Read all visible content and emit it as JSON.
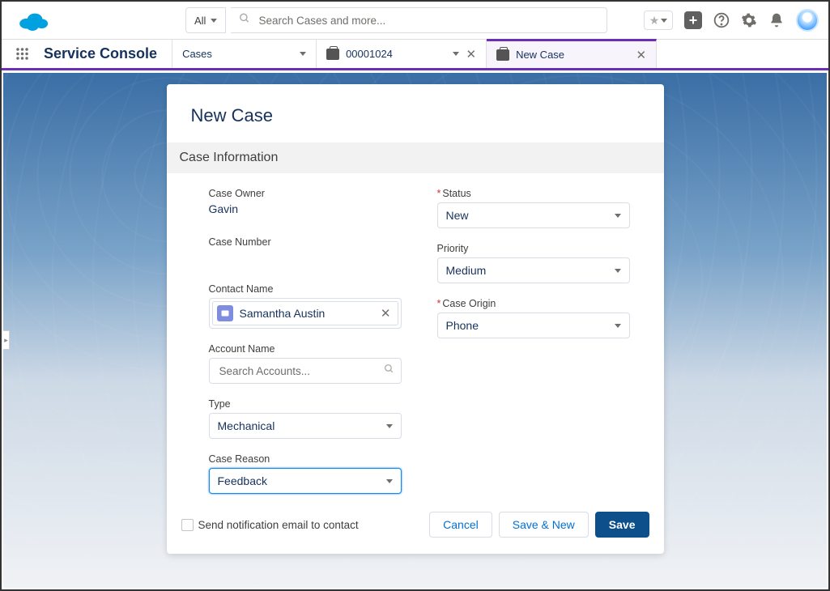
{
  "header": {
    "scope_label": "All",
    "search_placeholder": "Search Cases and more..."
  },
  "nav": {
    "app_name": "Service Console",
    "object_tab": "Cases",
    "record_tab": "00001024",
    "active_tab": "New Case"
  },
  "modal": {
    "title": "New Case",
    "section": "Case Information",
    "fields": {
      "case_owner_label": "Case Owner",
      "case_owner_value": "Gavin",
      "case_number_label": "Case Number",
      "contact_name_label": "Contact Name",
      "contact_name_value": "Samantha Austin",
      "account_name_label": "Account Name",
      "account_placeholder": "Search Accounts...",
      "type_label": "Type",
      "type_value": "Mechanical",
      "case_reason_label": "Case Reason",
      "case_reason_value": "Feedback",
      "status_label": "Status",
      "status_value": "New",
      "priority_label": "Priority",
      "priority_value": "Medium",
      "case_origin_label": "Case Origin",
      "case_origin_value": "Phone"
    },
    "footer": {
      "checkbox_label": "Send notification email to contact",
      "cancel": "Cancel",
      "save_new": "Save & New",
      "save": "Save"
    }
  }
}
